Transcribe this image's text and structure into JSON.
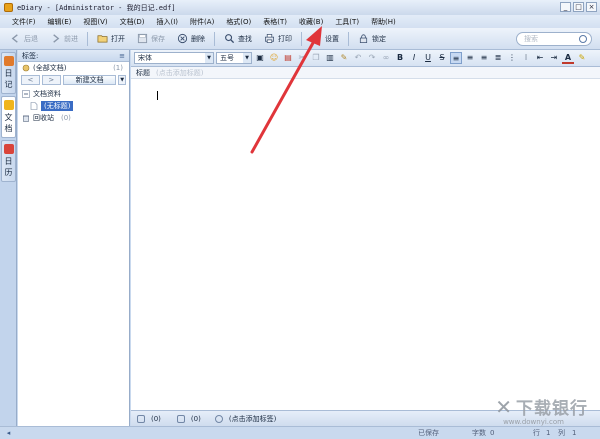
{
  "window": {
    "title": "eDiary - [Administrator - 我的日记.edf]",
    "controls": [
      "_",
      "□",
      "×"
    ]
  },
  "menu": [
    "文件(F)",
    "编辑(E)",
    "视图(V)",
    "文档(D)",
    "插入(I)",
    "附件(A)",
    "格式(O)",
    "表格(T)",
    "收藏(B)",
    "工具(T)",
    "帮助(H)"
  ],
  "toolbar": {
    "back": "后退",
    "forward": "前进",
    "open": "打开",
    "save": "保存",
    "delete": "删除",
    "find": "查找",
    "print": "打印",
    "settings": "设置",
    "lock": "锁定",
    "search_placeholder": "搜索"
  },
  "leftnav": {
    "tabs": [
      {
        "label": "日记",
        "chars": [
          "日",
          "记"
        ],
        "color": "#e07a2c"
      },
      {
        "label": "文档",
        "chars": [
          "文",
          "档"
        ],
        "color": "#f0b51c"
      },
      {
        "label": "日历",
        "chars": [
          "日",
          "历"
        ],
        "color": "#d9443a"
      }
    ]
  },
  "sidebar": {
    "tag_header": "标签:",
    "all_docs": "(全部文档)",
    "all_count": "(1)",
    "new_doc": "新建文档",
    "tree_root": "文档资料",
    "tree_child": "(无标题)",
    "recycle": "回收站",
    "recycle_count": "(0)"
  },
  "editor": {
    "font": "宋体",
    "size": "五号",
    "title_label": "标题",
    "title_placeholder": "(点击添加标题)",
    "fmt_bold": "B",
    "fmt_italic": "I",
    "fmt_underline": "U",
    "fmt_color": "A"
  },
  "status": {
    "attach_count": "(0)",
    "comment_count": "(0)",
    "tag_hint": "(点击添加标签)"
  },
  "bottom": {
    "saved": "已保存",
    "word_label": "字数",
    "word_count": "0",
    "row_label": "行",
    "row_value": "1",
    "col_label": "列",
    "col_value": "1"
  },
  "watermark": {
    "brand": "下载银行",
    "url": "www.downyi.com"
  },
  "colors": {
    "annotation_arrow": "#e0353a",
    "selection": "#3a6cc4"
  }
}
